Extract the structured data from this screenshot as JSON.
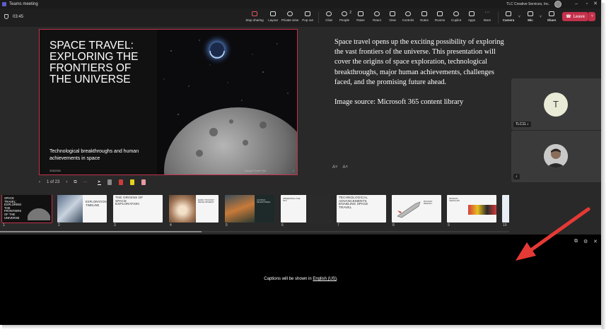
{
  "window": {
    "title": "Teams meeting",
    "org": "TLC Creative Services, Inc.",
    "minimize": "–",
    "maximize": "▫",
    "close": "✕"
  },
  "toolbar": {
    "timer": "03:45",
    "stop_sharing": "Stop sharing",
    "layout": "Layout",
    "private_view": "Private view",
    "pop_out": "Pop out",
    "chat": "Chat",
    "people": "People",
    "people_count": "2",
    "raise": "Raise",
    "react": "React",
    "view": "View",
    "controls": "Controls",
    "notes": "Notes",
    "rooms": "Rooms",
    "copilot": "Copilot",
    "apps": "Apps",
    "more": "More",
    "camera": "Camera",
    "mic": "Mic",
    "share": "Share",
    "leave": "Leave"
  },
  "slide": {
    "title": "SPACE TRAVEL: EXPLORING THE FRONTIERS OF THE UNIVERSE",
    "subtitle": "Technological breakthroughs and human achievements in space",
    "date": "3/25/2026",
    "footer": "Sample Footer Text",
    "page": "1"
  },
  "notes": {
    "p1": "Space travel opens up the exciting possibility of exploring the vast frontiers of the universe. This presentation will cover the origins of space exploration, technological breakthroughs, major human achievements, challenges faced, and the promising future ahead.",
    "p2": "Image source: Microsoft 365 content library",
    "font_down": "A˅",
    "font_up": "A˄"
  },
  "participants": {
    "t_initial": "T",
    "t_name": "TLC11"
  },
  "slide_controls": {
    "prev": "‹",
    "counter": "1 of 23",
    "next": "›",
    "more": "···"
  },
  "thumbnails": [
    {
      "num": "1",
      "text": "SPACE TRAVEL: EXPLORING THE FRONTIERS OF THE UNIVERSE"
    },
    {
      "num": "2",
      "text": "EXPLORATION TIMELINE"
    },
    {
      "num": "3",
      "text": "THE ORIGINS OF SPACE EXPLORATION"
    },
    {
      "num": "4",
      "text": "EARLY ROCKET DEVELOPMENT"
    },
    {
      "num": "5",
      "text": "LAUNCH MILESTONES"
    },
    {
      "num": "6",
      "text": "OBSERVING THE SKY"
    },
    {
      "num": "7",
      "text": "TECHNOLOGICAL ADVANCEMENTS ENABLING SPACE TRAVEL"
    },
    {
      "num": "8",
      "text": "ROCKET DESIGN"
    },
    {
      "num": "9",
      "text": "MISSION VEHICLES"
    },
    {
      "num": "10",
      "text": ""
    }
  ],
  "captions": {
    "prefix": "Captions will be shown in",
    "language": "English (US)",
    "suffix": "."
  }
}
